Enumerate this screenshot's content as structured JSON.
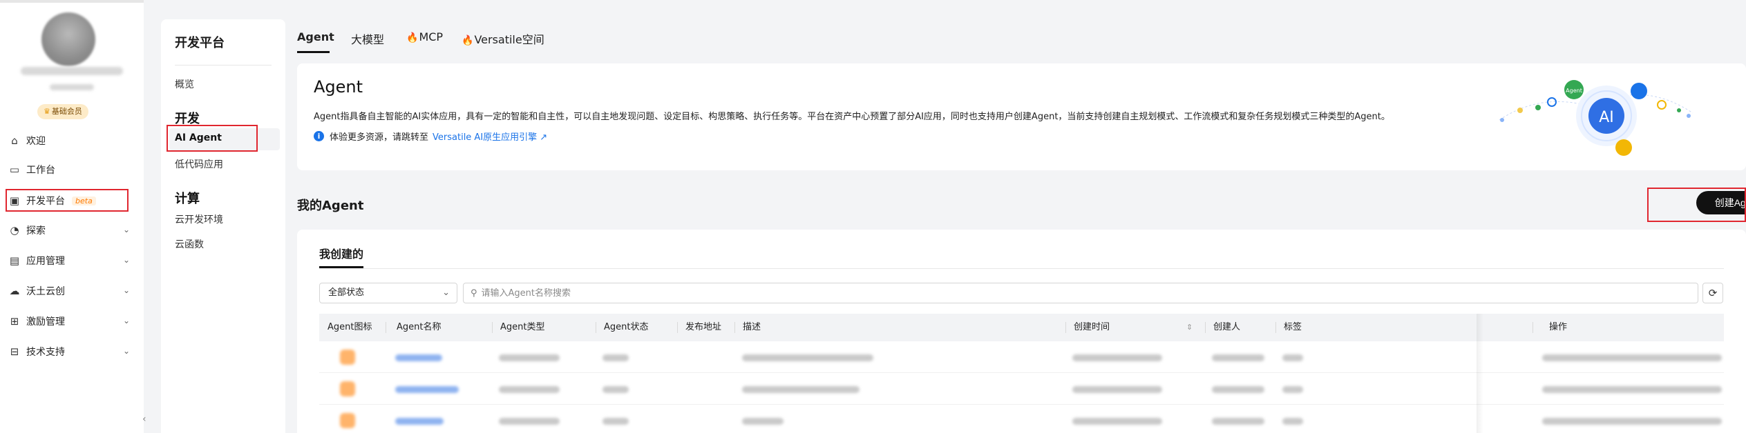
{
  "sidebar": {
    "member_badge": "基础会员",
    "items": [
      {
        "label": "欢迎",
        "icon": "home-icon"
      },
      {
        "label": "工作台",
        "icon": "monitor-icon"
      },
      {
        "label": "开发平台",
        "icon": "code-icon",
        "badge": "beta"
      },
      {
        "label": "探索",
        "icon": "explore-icon"
      },
      {
        "label": "应用管理",
        "icon": "app-manage-icon"
      },
      {
        "label": "沃土云创",
        "icon": "cloud-icon"
      },
      {
        "label": "激励管理",
        "icon": "gift-icon"
      },
      {
        "label": "技术支持",
        "icon": "support-icon"
      }
    ]
  },
  "subnav": {
    "title": "开发平台",
    "overview": "概览",
    "dev_section": "开发",
    "ai_agent": "AI Agent",
    "lowcode": "低代码应用",
    "compute_section": "计算",
    "cloud_dev": "云开发环境",
    "cloud_func": "云函数"
  },
  "tabs": [
    "Agent",
    "大模型",
    "MCP",
    "Versatile空间"
  ],
  "agent_card": {
    "title": "Agent",
    "description": "Agent指具备自主智能的AI实体应用，具有一定的智能和自主性，可以自主地发现问题、设定目标、构思策略、执行任务等。平台在资产中心预置了部分AI应用，同时也支持用户创建Agent，当前支持创建自主规划模式、工作流模式和复杂任务规划模式三种类型的Agent。",
    "info_prefix": "体验更多资源，请跳转至",
    "info_link": "Versatile AI原生应用引擎",
    "illus_badge_agent": "Agent",
    "illus_center": "AI"
  },
  "my_agent": {
    "title": "我的Agent",
    "create_button": "创建Agent",
    "inner_tab": "我创建的",
    "status_select": "全部状态",
    "search_placeholder": "请输入Agent名称搜索",
    "columns": [
      "Agent图标",
      "Agent名称",
      "Agent类型",
      "Agent状态",
      "发布地址",
      "描述",
      "创建时间",
      "创建人",
      "标签",
      "操作"
    ]
  },
  "colors": {
    "accent_link": "#1a73e8",
    "highlight_box": "#e0262f",
    "beta_badge": "#ff7a00",
    "fire": "#ff5a1f"
  }
}
